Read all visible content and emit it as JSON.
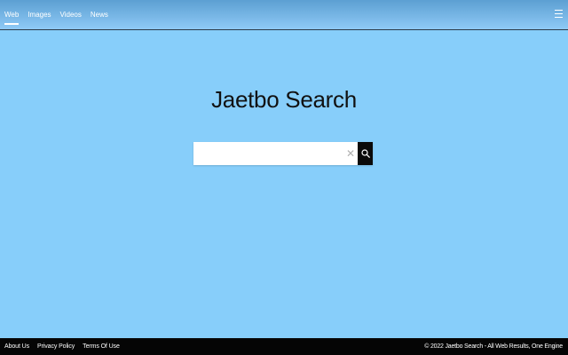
{
  "nav": {
    "items": [
      {
        "label": "Web",
        "active": true
      },
      {
        "label": "Images",
        "active": false
      },
      {
        "label": "Videos",
        "active": false
      },
      {
        "label": "News",
        "active": false
      }
    ]
  },
  "main": {
    "title": "Jaetbo Search",
    "search": {
      "value": "",
      "placeholder": "",
      "clear_glyph": "✕"
    }
  },
  "footer": {
    "links": [
      {
        "label": "About Us"
      },
      {
        "label": "Privacy Policy"
      },
      {
        "label": "Terms Of Use"
      }
    ],
    "copyright": "© 2022 Jaetbo Search - All Web Results, One Engine"
  },
  "icons": {
    "menu": "hamburger-menu-icon",
    "clear": "close-icon",
    "search": "search-icon"
  },
  "colors": {
    "page_background": "#87cefa",
    "header_gradient_top": "#5c9fd2",
    "header_gradient_bottom": "#8fcaf6",
    "footer_background": "#050505",
    "search_button": "#0a0a0a",
    "title_text": "#111111"
  }
}
